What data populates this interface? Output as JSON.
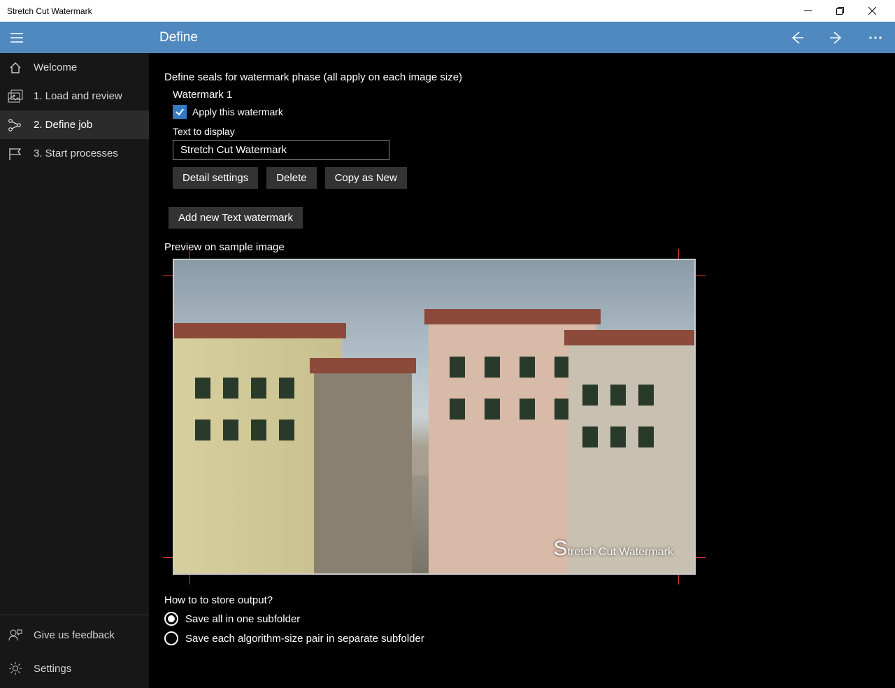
{
  "window": {
    "title": "Stretch Cut Watermark"
  },
  "header": {
    "title": "Define"
  },
  "sidebar": {
    "items": [
      {
        "label": "Welcome",
        "icon": "home"
      },
      {
        "label": "1. Load and review",
        "icon": "images"
      },
      {
        "label": "2. Define job",
        "icon": "graph",
        "active": true
      },
      {
        "label": "3. Start processes",
        "icon": "flag"
      }
    ],
    "bottom": [
      {
        "label": "Give us feedback",
        "icon": "feedback"
      },
      {
        "label": "Settings",
        "icon": "gear"
      }
    ]
  },
  "main": {
    "seals_heading": "Define seals for watermark phase (all apply on each image size)",
    "watermark1": {
      "title": "Watermark 1",
      "apply_label": "Apply this watermark",
      "apply_checked": true,
      "text_label": "Text to display",
      "text_value": "Stretch Cut Watermark",
      "detail_btn": "Detail settings",
      "delete_btn": "Delete",
      "copy_btn": "Copy as New"
    },
    "add_watermark_btn": "Add new Text watermark",
    "preview_label": "Preview on sample image",
    "preview_watermark_text": "tretch Cut Watermark",
    "preview_watermark_big": "S",
    "output_heading": "How to to store output?",
    "output_options": [
      {
        "label": "Save all in one subfolder",
        "selected": true
      },
      {
        "label": "Save each algorithm-size pair in separate subfolder",
        "selected": false
      }
    ]
  }
}
